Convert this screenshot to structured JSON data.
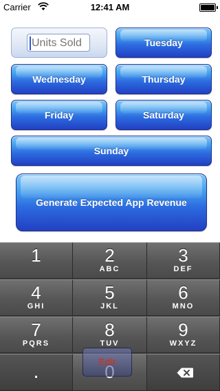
{
  "status_bar": {
    "carrier": "Carrier",
    "time": "12:41 AM"
  },
  "units_field": {
    "placeholder": "Units Sold",
    "value": ""
  },
  "day_buttons": {
    "tuesday": "Tuesday",
    "wednesday": "Wednesday",
    "thursday": "Thursday",
    "friday": "Friday",
    "saturday": "Saturday",
    "sunday": "Sunday"
  },
  "generate_button": "Generate Expected App Revenue",
  "edit_button": "Edit",
  "keypad": {
    "k1": {
      "num": "1",
      "letters": ""
    },
    "k2": {
      "num": "2",
      "letters": "ABC"
    },
    "k3": {
      "num": "3",
      "letters": "DEF"
    },
    "k4": {
      "num": "4",
      "letters": "GHI"
    },
    "k5": {
      "num": "5",
      "letters": "JKL"
    },
    "k6": {
      "num": "6",
      "letters": "MNO"
    },
    "k7": {
      "num": "7",
      "letters": "PQRS"
    },
    "k8": {
      "num": "8",
      "letters": "TUV"
    },
    "k9": {
      "num": "9",
      "letters": "WXYZ"
    },
    "dot": ".",
    "k0": {
      "num": "0",
      "letters": ""
    }
  },
  "icons": {
    "wifi": "wifi-icon",
    "battery": "battery-icon",
    "backspace": "backspace-icon"
  },
  "battery_level": 1.0,
  "colors": {
    "button_blue": "#2c6be0",
    "keypad_gray": "#565656",
    "edit_text": "#c0392b"
  }
}
